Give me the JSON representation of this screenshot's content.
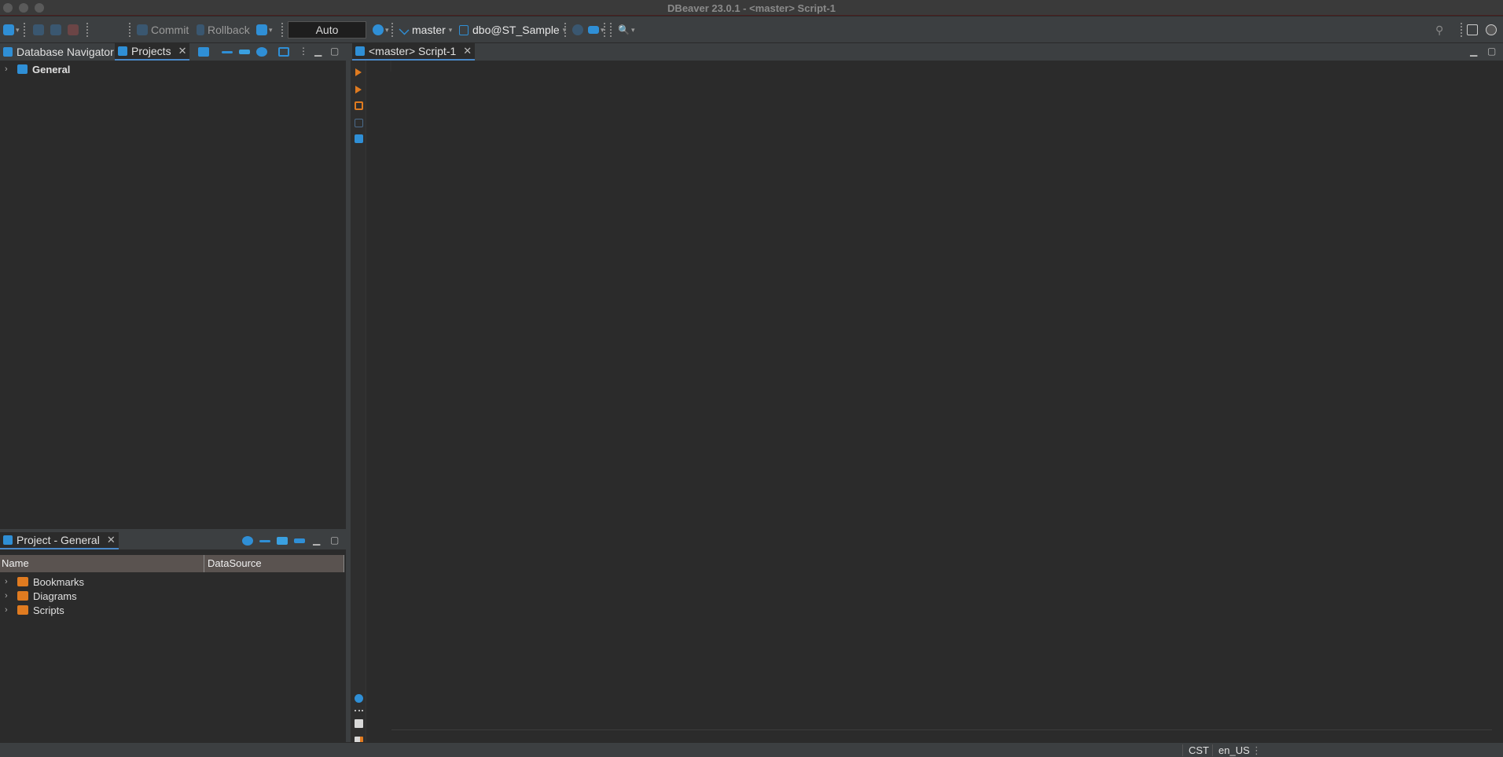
{
  "window": {
    "title": "DBeaver 23.0.1 - <master> Script-1"
  },
  "toolbar": {
    "commit_label": "Commit",
    "rollback_label": "Rollback",
    "transaction_mode": "Auto",
    "datasource": "master",
    "schema": "dbo@ST_Sample"
  },
  "left_panel": {
    "tabs": [
      {
        "label": "Database Navigator"
      },
      {
        "label": "Projects"
      }
    ],
    "tree": [
      {
        "label": "General"
      }
    ]
  },
  "project_panel": {
    "tab_label": "Project - General",
    "columns": [
      "Name",
      "DataSource"
    ],
    "items": [
      {
        "label": "Bookmarks"
      },
      {
        "label": "Diagrams"
      },
      {
        "label": "Scripts"
      }
    ]
  },
  "editor": {
    "tab_label": "<master> Script-1"
  },
  "statusbar": {
    "timezone": "CST",
    "locale": "en_US"
  },
  "colors": {
    "accent": "#2f8fd6",
    "folder": "#e07b20",
    "background": "#2b2b2b",
    "chrome": "#3c3f41"
  }
}
